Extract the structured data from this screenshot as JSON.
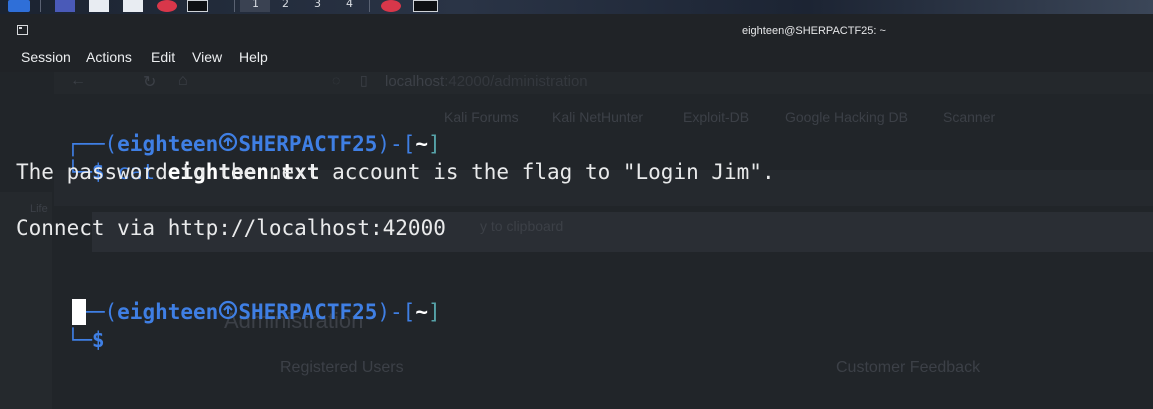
{
  "window": {
    "title": "eighteen@SHERPACTF25: ~"
  },
  "taskbar": {
    "workspaces": [
      "1",
      "2",
      "3",
      "4"
    ]
  },
  "menubar": {
    "items": [
      "Session",
      "Actions",
      "Edit",
      "View",
      "Help"
    ]
  },
  "background_browser": {
    "url_host": "localhost",
    "url_rest": ":42000/administration",
    "bookmarks": [
      "Kali Forums",
      "Kali NetHunter",
      "Exploit-DB",
      "Google Hacking DB",
      "Scanner"
    ],
    "clipboard_hint": "y to clipboard",
    "heading": "Administration",
    "col_left": "Registered Users",
    "col_right": "Customer Feedback",
    "side_label": "Life"
  },
  "terminal": {
    "prompt1": {
      "frame_open": "┌──(",
      "user": "eighteen",
      "host": "SHERPACTF25",
      "mid": ")-[",
      "cwd": "~",
      "close": "]",
      "line2_frame": "└─",
      "dollar": "$",
      "cmd": "cat",
      "arg": "eighteen.txt"
    },
    "output": [
      "The password to the next account is the flag to \"Login Jim\".",
      "",
      "Connect via http://localhost:42000"
    ],
    "prompt2": {
      "frame_open": "┌──(",
      "user": "eighteen",
      "host": "SHERPACTF25",
      "mid": ")-[",
      "cwd": "~",
      "close": "]",
      "line2_frame": "└─",
      "dollar": "$"
    }
  },
  "colors": {
    "terminal_bg": "#212529",
    "prompt_blue": "#3f7fe4",
    "bracket_teal": "#56a3a9",
    "text": "#e9eaeb"
  }
}
